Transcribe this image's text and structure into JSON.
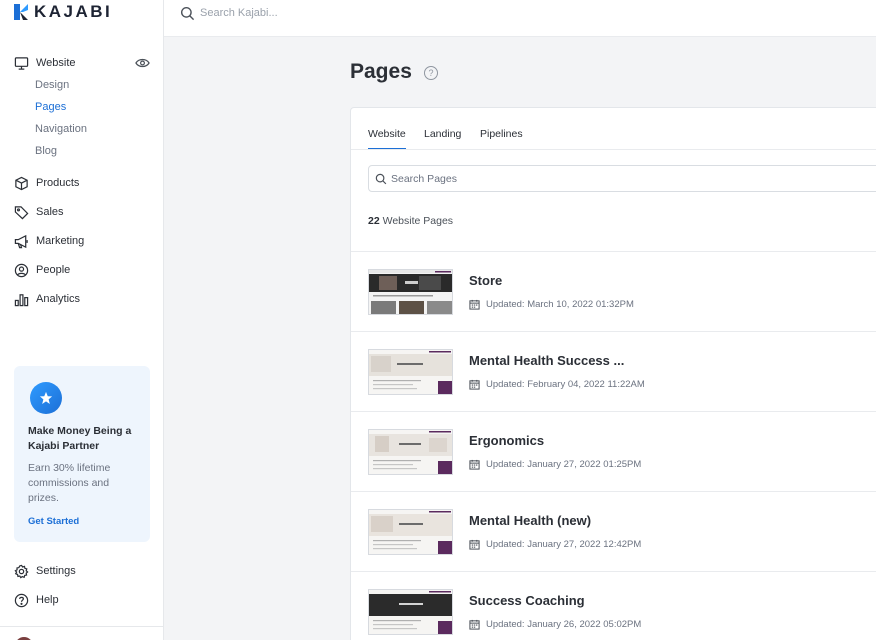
{
  "app": {
    "brand": "KAJABI",
    "search_placeholder": "Search Kajabi..."
  },
  "sidebar": {
    "website_label": "Website",
    "website_subitems": [
      "Design",
      "Pages",
      "Navigation",
      "Blog"
    ],
    "active_subitem": "Pages",
    "items": [
      {
        "label": "Products",
        "icon": "box-icon"
      },
      {
        "label": "Sales",
        "icon": "tag-icon"
      },
      {
        "label": "Marketing",
        "icon": "megaphone-icon"
      },
      {
        "label": "People",
        "icon": "person-circle-icon"
      },
      {
        "label": "Analytics",
        "icon": "bar-chart-icon"
      }
    ],
    "promo": {
      "title": "Make Money Being a Kajabi Partner",
      "body": "Earn 30% lifetime commissions and prizes.",
      "link": "Get Started"
    },
    "settings_label": "Settings",
    "help_label": "Help"
  },
  "main": {
    "title": "Pages",
    "tabs": [
      "Website",
      "Landing",
      "Pipelines"
    ],
    "active_tab": "Website",
    "search_placeholder": "Search Pages",
    "count_number": "22",
    "count_label": "Website Pages",
    "pages": [
      {
        "title": "Store",
        "updated": "Updated: March 10, 2022 01:32PM",
        "thumb": "dark"
      },
      {
        "title": "Mental Health Success ...",
        "updated": "Updated: February 04, 2022 11:22AM",
        "thumb": "light"
      },
      {
        "title": "Ergonomics",
        "updated": "Updated: January 27, 2022 01:25PM",
        "thumb": "light"
      },
      {
        "title": "Mental Health (new)",
        "updated": "Updated: January 27, 2022 12:42PM",
        "thumb": "light"
      },
      {
        "title": "Success Coaching",
        "updated": "Updated: January 26, 2022 05:02PM",
        "thumb": "dark"
      }
    ]
  },
  "colors": {
    "accent": "#1c6fd6",
    "promo_bg": "#eef5fd",
    "thumb_purple": "#5b2a5e"
  }
}
